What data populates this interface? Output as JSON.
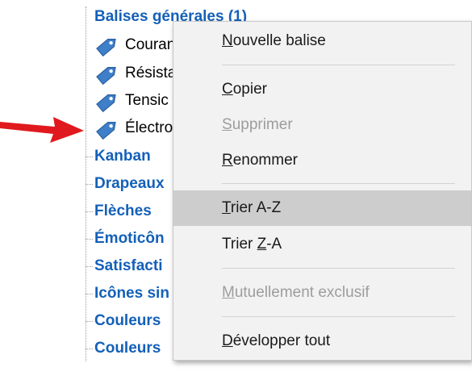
{
  "tree": {
    "header": "Balises générales (1)",
    "children": [
      {
        "label": "Couran"
      },
      {
        "label": "Résista"
      },
      {
        "label": "Tensic"
      },
      {
        "label": "Électro"
      }
    ],
    "categories": [
      {
        "label": "Kanban"
      },
      {
        "label": "Drapeaux"
      },
      {
        "label": "Flèches"
      },
      {
        "label": "Émoticôn"
      },
      {
        "label": "Satisfacti"
      },
      {
        "label": "Icônes sin"
      },
      {
        "label": "Couleurs"
      },
      {
        "label": "Couleurs"
      }
    ]
  },
  "menu": {
    "new_tag": {
      "pre": "",
      "key": "N",
      "post": "ouvelle balise"
    },
    "copy": {
      "pre": "",
      "key": "C",
      "post": "opier"
    },
    "delete": {
      "pre": "",
      "key": "S",
      "post": "upprimer",
      "disabled": true
    },
    "rename": {
      "pre": "",
      "key": "R",
      "post": "enommer"
    },
    "sort_az": {
      "pre": "",
      "key": "T",
      "post": "rier A-Z",
      "highlighted": true
    },
    "sort_za": {
      "pre": "Trier ",
      "key": "Z",
      "post": "-A"
    },
    "mutually_exclusive": {
      "pre": "",
      "key": "M",
      "post": "utuellement exclusif",
      "disabled": true
    },
    "expand_all": {
      "pre": "",
      "key": "D",
      "post": "évelopper tout"
    }
  },
  "colors": {
    "category_text": "#1460b8",
    "tag_icon": "#3f7fc9",
    "arrow": "#e0191e",
    "menu_bg": "#f2f2f2",
    "highlight_bg": "#cdcdcd"
  },
  "icons": {
    "tag": "tag-icon",
    "arrow": "red-arrow-icon"
  }
}
